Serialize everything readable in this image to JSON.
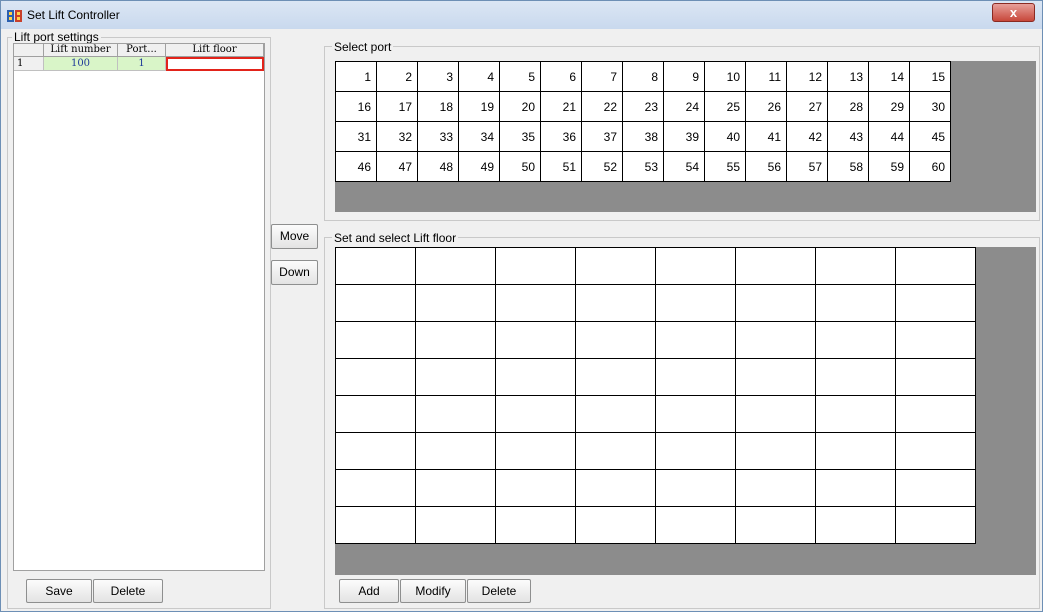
{
  "window": {
    "title": "Set Lift Controller",
    "close_glyph": "x",
    "icon": "app-icon"
  },
  "lift_port_settings": {
    "legend": "Lift port settings",
    "columns": [
      "",
      "Lift number",
      "Port...",
      "Lift floor"
    ],
    "rows": [
      {
        "index": "1",
        "lift_number": "100",
        "port": "1",
        "lift_floor": ""
      }
    ],
    "buttons": {
      "save": "Save",
      "delete": "Delete"
    }
  },
  "middle_buttons": {
    "move": "Move",
    "down": "Down"
  },
  "select_port": {
    "legend": "Select port",
    "ports": [
      [
        "1",
        "2",
        "3",
        "4",
        "5",
        "6",
        "7",
        "8",
        "9",
        "10",
        "11",
        "12",
        "13",
        "14",
        "15"
      ],
      [
        "16",
        "17",
        "18",
        "19",
        "20",
        "21",
        "22",
        "23",
        "24",
        "25",
        "26",
        "27",
        "28",
        "29",
        "30"
      ],
      [
        "31",
        "32",
        "33",
        "34",
        "35",
        "36",
        "37",
        "38",
        "39",
        "40",
        "41",
        "42",
        "43",
        "44",
        "45"
      ],
      [
        "46",
        "47",
        "48",
        "49",
        "50",
        "51",
        "52",
        "53",
        "54",
        "55",
        "56",
        "57",
        "58",
        "59",
        "60"
      ]
    ]
  },
  "lift_floor": {
    "legend": "Set and select Lift floor",
    "buttons": {
      "add": "Add",
      "modify": "Modify",
      "delete": "Delete"
    }
  },
  "colors": {
    "selected_cell_border": "#e2231a",
    "row_highlight": "#d9f5c8",
    "gray_area": "#8c8c8c"
  }
}
